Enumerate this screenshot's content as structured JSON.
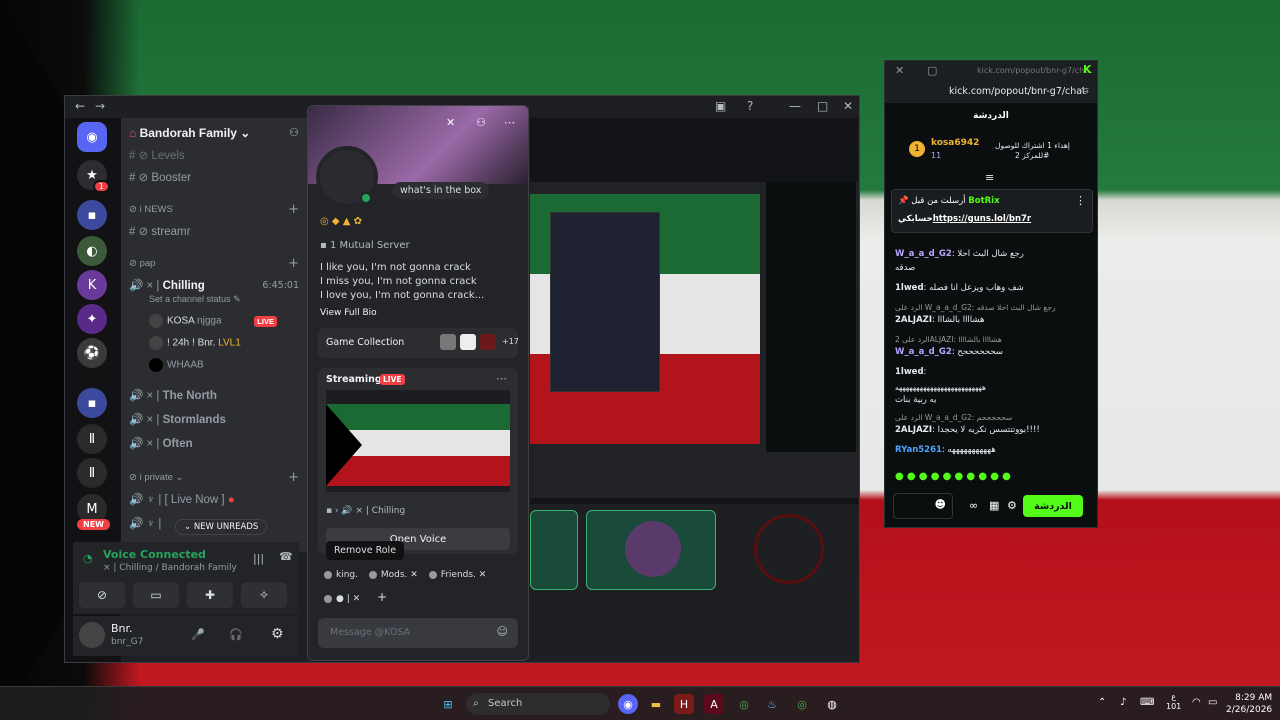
{
  "discord": {
    "server_name": "Bandorah Family",
    "channels": {
      "levels": "Levels",
      "booster": "Booster",
      "cat_news": "i NEWS",
      "streamr": "streamr",
      "cat_pap": "pap",
      "chilling": "Chilling",
      "chilling_time": "6:45:01",
      "set_status": "Set a channel status",
      "voice_users": [
        {
          "name": "KOSA",
          "tag": "njgga",
          "live": "LIVE"
        },
        {
          "name": "! 24h ! Bnr.",
          "tag": "LVL1"
        },
        {
          "name": "WHAAB"
        }
      ],
      "the_north": "The North",
      "stormlands": "Stormlands",
      "often": "Often",
      "cat_private": "i private",
      "live_now": "[ Live Now ]"
    },
    "new_pill": "NEW",
    "new_unreads": "NEW UNREADS",
    "voice_connected": "Voice Connected",
    "voice_channel": "Chilling / Bandorah Family",
    "user": {
      "name": "Bnr.",
      "tag": "bnr_G7"
    }
  },
  "profile": {
    "status_bubble": "what's in the box",
    "mutual": "1 Mutual Server",
    "bio": [
      "I like you, I'm not gonna crack",
      "I miss you, I'm not gonna crack",
      "I love you, I'm not gonna crack..."
    ],
    "view_bio": "View Full Bio",
    "game_collection": "Game Collection",
    "game_more": "+17",
    "streaming": "Streaming",
    "live": "LIVE",
    "stream_channel": "Chilling",
    "open_voice": "Open Voice",
    "tooltip": "Remove Role",
    "roles": [
      "king.",
      "Mods.",
      "Friends."
    ],
    "message_placeholder": "Message @KOSA"
  },
  "kick": {
    "url": "kick.com/popout/bnr-g7/chat",
    "url_short": "kick.com/popout/bnr-g7/ch...",
    "chat_title": "الدردشة",
    "gifter_name": "kosa6942",
    "gifter_count": "11",
    "gift_text": "إهداء 1 اشتراك للوصول",
    "gift_text2": "2 للمركز#",
    "pinned_user": "BotRix",
    "pinned_prefix": "أرسلت من قبل",
    "pinned_link": "https://guns.lol/bn7r",
    "pinned_suffix": "حسابكي",
    "messages": [
      {
        "user": "W_a_a_d_G2",
        "text": "رجع شال البث احلا",
        "extra": "صدقه"
      },
      {
        "user": "1lwed",
        "text": "شف وهاب ويزعل انا فصله"
      },
      {
        "reply": "الرد على W_a_a_d_G2: رجع شال البث احلا صدقه",
        "user": "2ALJAZI",
        "text": "هشاااا بالشااا"
      },
      {
        "reply": "الرد على 2ALJAZI: هشاااا بالشاااا",
        "user": "W_a_a_d_G2",
        "text": "سححححححح"
      },
      {
        "user": "1lwed",
        "text": "هههههههههههههههههههههههههه",
        "extra": "يه ربية بنات"
      },
      {
        "reply": "الرد على W_a_a_d_G2: سحححححم",
        "user": "2ALJAZI",
        "text": "بووتتتسس تكريه لا يحجدا!!!!"
      },
      {
        "user": "RYan5261",
        "text": "هههههههههههه"
      }
    ],
    "chat_button": "الدردشة"
  },
  "taskbar": {
    "search": "Search",
    "time": "8:29 AM",
    "date": "2/26/2026",
    "lang": "ع",
    "lang2": "101"
  }
}
